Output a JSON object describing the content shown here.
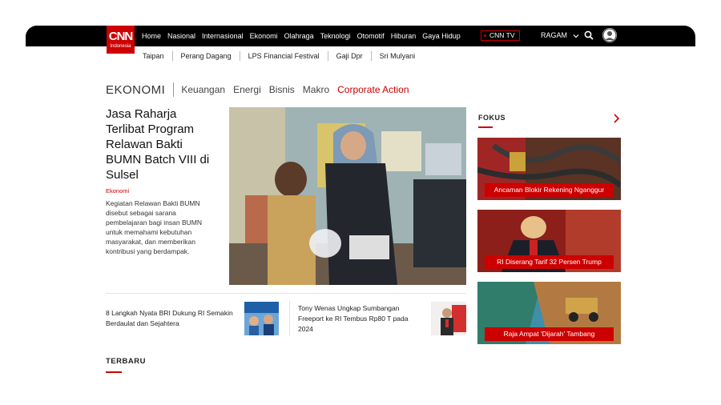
{
  "header": {
    "logo_main": "CNN",
    "logo_sub": "Indonesia",
    "nav": [
      "Home",
      "Nasional",
      "Internasional",
      "Ekonomi",
      "Olahraga",
      "Teknologi",
      "Otomotif",
      "Hiburan",
      "Gaya Hidup"
    ],
    "cnn_tv": "CNN TV",
    "ragam": "RAGAM"
  },
  "subnav": [
    "Taipan",
    "Perang Dagang",
    "LPS Financial Festival",
    "Gaji Dpr",
    "Sri Mulyani"
  ],
  "section": {
    "title": "EKONOMI",
    "subs": [
      "Keuangan",
      "Energi",
      "Bisnis",
      "Makro",
      "Corporate Action"
    ]
  },
  "headline": {
    "title": "Jasa Raharja Terlibat Program Relawan Bakti BUMN Batch VIII di Sulsel",
    "category": "Ekonomi",
    "summary": "Kegiatan Relawan Bakti BUMN disebut sebagai sarana pembelajaran bagi insan BUMN untuk memahami kebutuhan masyarakat, dan memberikan kontribusi yang berdampak."
  },
  "related": [
    {
      "title": "8 Langkah Nyata BRI Dukung RI Semakin Berdaulat dan Sejahtera"
    },
    {
      "title": "Tony Wenas Ungkap Sumbangan Freeport ke RI Tembus Rp80 T pada 2024"
    }
  ],
  "terbaru": "TERBARU",
  "fokus": {
    "title": "FOKUS",
    "cards": [
      {
        "label": "Ancaman Blokir Rekening Nganggur"
      },
      {
        "label": "RI Diserang Tarif 32 Persen Trump"
      },
      {
        "label": "Raja Ampat 'Dijarah' Tambang"
      }
    ]
  },
  "colors": {
    "accent": "#cc0000",
    "topbar": "#000000"
  },
  "icons": {
    "search": "search-icon",
    "user": "user-icon",
    "chevron": "chevron-right-icon"
  }
}
